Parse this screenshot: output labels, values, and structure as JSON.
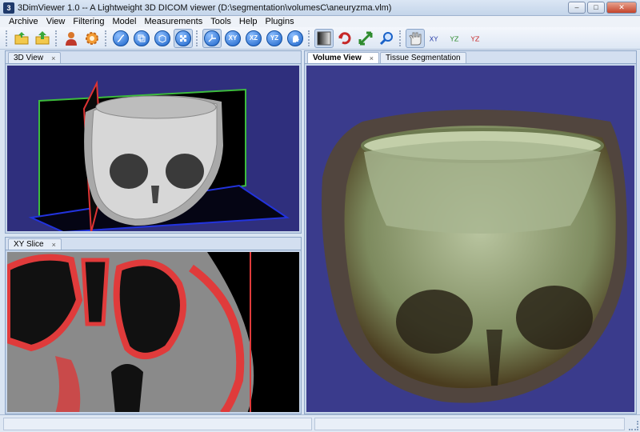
{
  "window": {
    "title": "3DimViewer 1.0 -- A Lightweight 3D DICOM viewer (D:\\segmentation\\volumesC\\aneuryzma.vlm)",
    "icon_letter": "3"
  },
  "menu": [
    "Archive",
    "View",
    "Filtering",
    "Model",
    "Measurements",
    "Tools",
    "Help",
    "Plugins"
  ],
  "toolbar": {
    "icons": [
      "open-folder",
      "save-upload",
      "user-person",
      "gear",
      "curve",
      "scene-tool",
      "cube",
      "checker-pattern",
      "axes",
      "xy-plane",
      "xz-plane",
      "yz-plane",
      "head-profile",
      "contrast-window",
      "rotate",
      "arrows-move",
      "magnifier",
      "hand",
      "xy-view",
      "yz-view-green",
      "yz-view-red"
    ],
    "labels": {
      "xy": "XY",
      "xz": "XZ",
      "yz": "YZ",
      "view_xy": "XY",
      "view_yz": "YZ",
      "view_yz2": "YZ"
    }
  },
  "panels": {
    "top_left": {
      "tabs": [
        {
          "label": "3D View",
          "active": false
        }
      ]
    },
    "bottom_left": {
      "tabs": [
        {
          "label": "XY Slice",
          "active": false
        }
      ]
    },
    "right": {
      "tabs": [
        {
          "label": "Volume View",
          "active": true
        },
        {
          "label": "Tissue Segmentation",
          "active": false
        }
      ]
    }
  },
  "tab_close_glyph": "×",
  "colors": {
    "viewport_bg_3d": "#2e2e7a",
    "volume_bg": "#3a3b8c",
    "slice_bg": "#000000",
    "highlight_red": "#e03b3b"
  }
}
